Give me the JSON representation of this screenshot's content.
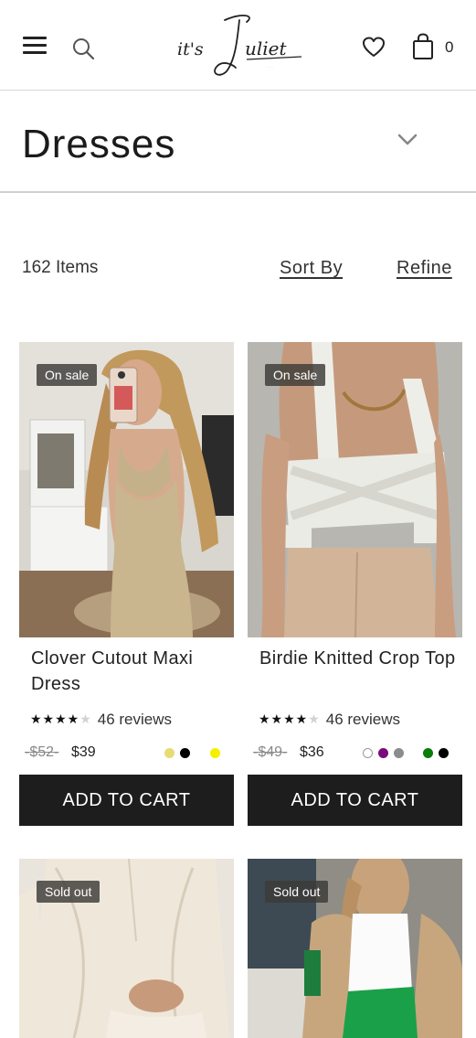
{
  "header": {
    "menu_icon": "hamburger-menu-icon",
    "search_icon": "search-icon",
    "logo_text": "it's Juliet",
    "wishlist_icon": "heart-icon",
    "cart_icon": "shopping-bag-icon",
    "cart_count": "0"
  },
  "page": {
    "title": "Dresses",
    "collapse_icon": "chevron-down-icon"
  },
  "toolbar": {
    "item_count": "162 Items",
    "sort_label": "Sort By",
    "refine_label": "Refine"
  },
  "products": [
    {
      "badge": "On sale",
      "name": "Clover Cutout Maxi Dress",
      "rating": 4,
      "reviews": "46 reviews",
      "old_price": "$52",
      "price": "$39",
      "swatches": [
        "#e7dc74",
        "#000000",
        "#f5f000"
      ],
      "cta": "ADD TO CART"
    },
    {
      "badge": "On sale",
      "name": "Birdie Knitted Crop Top",
      "rating": 4,
      "reviews": "46 reviews",
      "old_price": "$49",
      "price": "$36",
      "swatches": [
        "#ffffff",
        "#7a0a7a",
        "#8c8c8c",
        "#0a7d0a",
        "#000000"
      ],
      "cta": "ADD TO CART"
    },
    {
      "badge": "Sold out"
    },
    {
      "badge": "Sold out"
    }
  ],
  "colors": {
    "button_bg": "#1d1d1d",
    "badge_bg": "#3c3a37",
    "divider": "#d8d8d8"
  }
}
